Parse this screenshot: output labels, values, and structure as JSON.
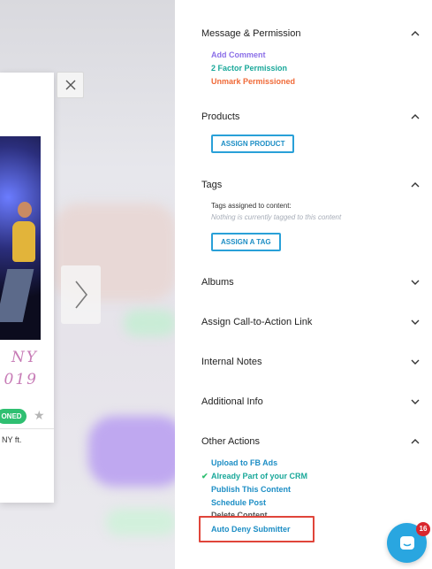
{
  "colors": {
    "accent_blue": "#1d8ec5",
    "link_purple": "#8b6fe8",
    "link_teal": "#1aa89a",
    "link_orange": "#f06a38",
    "green": "#2fbf71",
    "alert_red": "#e0453a"
  },
  "preview": {
    "script_line1": "NY",
    "script_line2": "019",
    "status_pill": "ONED",
    "snippet": "NY ft."
  },
  "sections": {
    "message_permission": {
      "title": "Message & Permission",
      "links": [
        "Add Comment",
        "2 Factor Permission",
        "Unmark Permissioned"
      ]
    },
    "products": {
      "title": "Products",
      "button": "ASSIGN PRODUCT"
    },
    "tags": {
      "title": "Tags",
      "label": "Tags assigned to content:",
      "hint": "Nothing is currently tagged to this content",
      "button": "ASSIGN A TAG"
    },
    "albums": {
      "title": "Albums"
    },
    "cta": {
      "title": "Assign Call-to-Action Link"
    },
    "notes": {
      "title": "Internal Notes"
    },
    "additional": {
      "title": "Additional Info"
    },
    "other": {
      "title": "Other Actions",
      "links": [
        "Upload to FB Ads",
        "Already Part of your CRM",
        "Publish This Content",
        "Schedule Post",
        "Delete Content",
        "Auto Deny Submitter"
      ]
    }
  },
  "chat": {
    "badge_count": "16"
  },
  "icons": {
    "close": "close-icon",
    "next": "chevron-right-icon",
    "up": "chevron-up-icon",
    "down": "chevron-down-icon",
    "check": "checkmark-icon",
    "chat": "chat-icon",
    "star": "star-icon"
  }
}
